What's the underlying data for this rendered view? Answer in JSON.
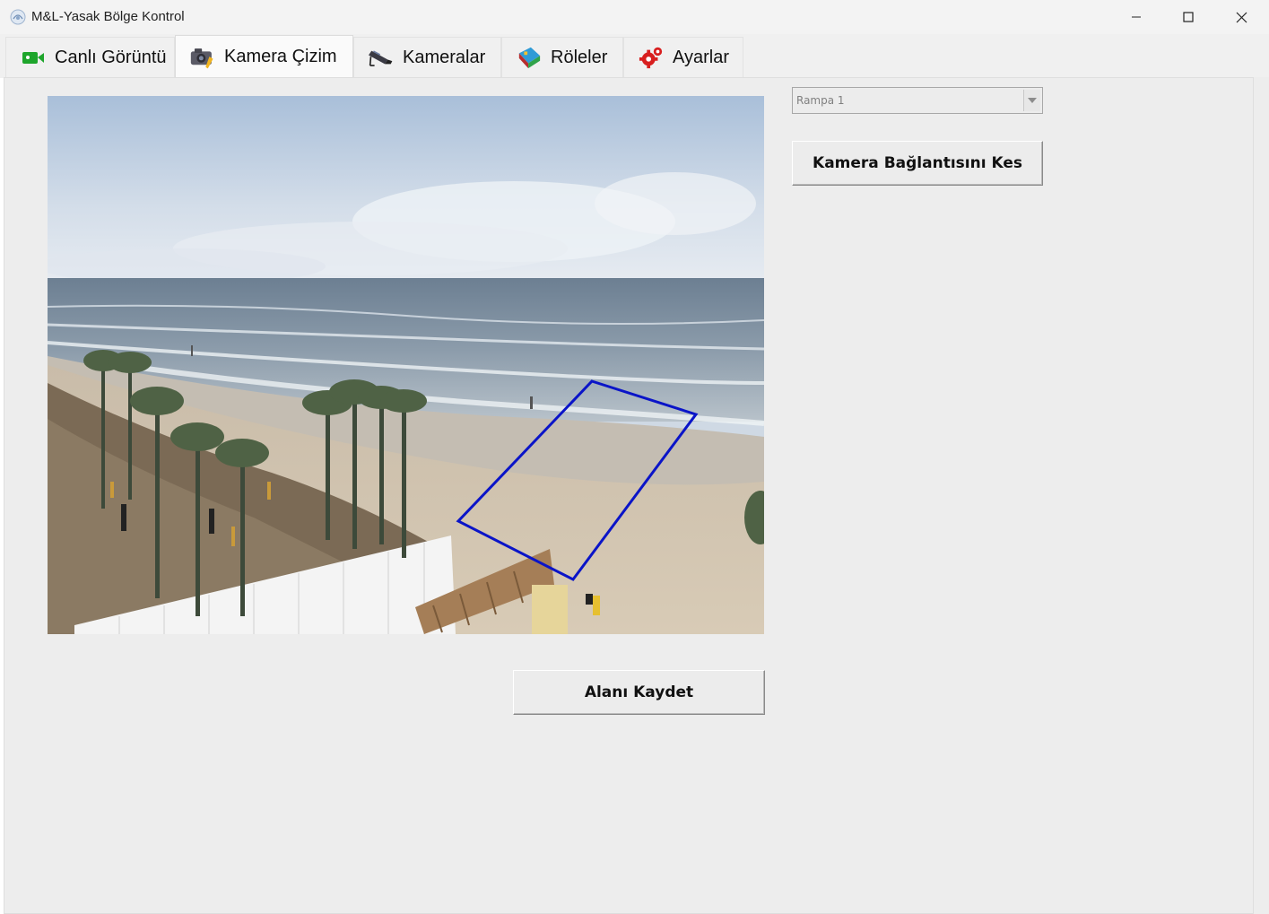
{
  "window": {
    "title": "M&L-Yasak Bölge Kontrol",
    "icon": "app-logo-icon",
    "controls": [
      "minimize-icon",
      "maximize-icon",
      "close-icon"
    ]
  },
  "tabs": [
    {
      "label": "Canlı Görüntü",
      "icon": "video-camera-icon",
      "active": false
    },
    {
      "label": "Kamera Çizim",
      "icon": "camera-draw-icon",
      "active": true
    },
    {
      "label": "Kameralar",
      "icon": "security-camera-icon",
      "active": false
    },
    {
      "label": "Röleler",
      "icon": "relay-icon",
      "active": false
    },
    {
      "label": "Ayarlar",
      "icon": "gear-icon",
      "active": false
    }
  ],
  "camera_select": {
    "selected": "Rampa 1",
    "icon": "chevron-down-icon"
  },
  "buttons": {
    "disconnect": "Kamera Bağlantısını Kes",
    "save_area": "Alanı Kaydet"
  },
  "camera_view": {
    "description_icon": "camera-feed-image",
    "zone_color": "#0a14c8"
  },
  "colors": {
    "panel_bg": "#ededed",
    "zone_stroke": "#0a14c8"
  }
}
